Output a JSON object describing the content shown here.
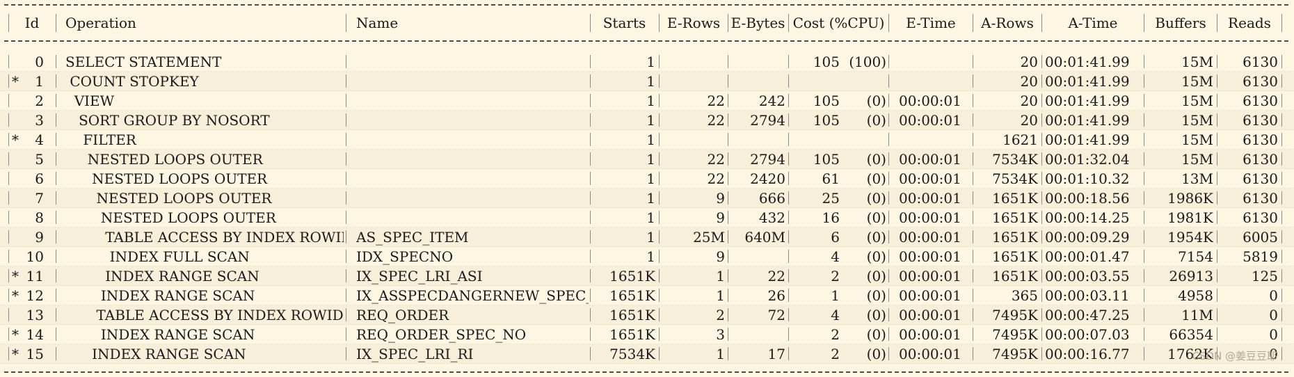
{
  "columns": {
    "id": "Id",
    "operation": "Operation",
    "name": "Name",
    "starts": "Starts",
    "erows": "E-Rows",
    "ebytes": "E-Bytes",
    "cost": "Cost (%CPU)",
    "etime": "E-Time",
    "arows": "A-Rows",
    "atime": "A-Time",
    "buffers": "Buffers",
    "reads": "Reads"
  },
  "rows": [
    {
      "mark": "",
      "id": "0",
      "operation": "SELECT STATEMENT",
      "name": "",
      "starts": "1",
      "erows": "",
      "ebytes": "",
      "cost": "105",
      "cpu": "(100)",
      "etime": "",
      "arows": "20",
      "atime": "00:01:41.99",
      "buffers": "15M",
      "reads": "6130"
    },
    {
      "mark": "*",
      "id": "1",
      "operation": " COUNT STOPKEY",
      "name": "",
      "starts": "1",
      "erows": "",
      "ebytes": "",
      "cost": "",
      "cpu": "",
      "etime": "",
      "arows": "20",
      "atime": "00:01:41.99",
      "buffers": "15M",
      "reads": "6130"
    },
    {
      "mark": "",
      "id": "2",
      "operation": "  VIEW",
      "name": "",
      "starts": "1",
      "erows": "22",
      "ebytes": "242",
      "cost": "105",
      "cpu": "(0)",
      "etime": "00:00:01",
      "arows": "20",
      "atime": "00:01:41.99",
      "buffers": "15M",
      "reads": "6130"
    },
    {
      "mark": "",
      "id": "3",
      "operation": "   SORT GROUP BY NOSORT",
      "name": "",
      "starts": "1",
      "erows": "22",
      "ebytes": "2794",
      "cost": "105",
      "cpu": "(0)",
      "etime": "00:00:01",
      "arows": "20",
      "atime": "00:01:41.99",
      "buffers": "15M",
      "reads": "6130"
    },
    {
      "mark": "*",
      "id": "4",
      "operation": "    FILTER",
      "name": "",
      "starts": "1",
      "erows": "",
      "ebytes": "",
      "cost": "",
      "cpu": "",
      "etime": "",
      "arows": "1621",
      "atime": "00:01:41.99",
      "buffers": "15M",
      "reads": "6130"
    },
    {
      "mark": "",
      "id": "5",
      "operation": "     NESTED LOOPS OUTER",
      "name": "",
      "starts": "1",
      "erows": "22",
      "ebytes": "2794",
      "cost": "105",
      "cpu": "(0)",
      "etime": "00:00:01",
      "arows": "7534K",
      "atime": "00:01:32.04",
      "buffers": "15M",
      "reads": "6130"
    },
    {
      "mark": "",
      "id": "6",
      "operation": "      NESTED LOOPS OUTER",
      "name": "",
      "starts": "1",
      "erows": "22",
      "ebytes": "2420",
      "cost": "61",
      "cpu": "(0)",
      "etime": "00:00:01",
      "arows": "7534K",
      "atime": "00:01:10.32",
      "buffers": "13M",
      "reads": "6130"
    },
    {
      "mark": "",
      "id": "7",
      "operation": "       NESTED LOOPS OUTER",
      "name": "",
      "starts": "1",
      "erows": "9",
      "ebytes": "666",
      "cost": "25",
      "cpu": "(0)",
      "etime": "00:00:01",
      "arows": "1651K",
      "atime": "00:00:18.56",
      "buffers": "1986K",
      "reads": "6130"
    },
    {
      "mark": "",
      "id": "8",
      "operation": "        NESTED LOOPS OUTER",
      "name": "",
      "starts": "1",
      "erows": "9",
      "ebytes": "432",
      "cost": "16",
      "cpu": "(0)",
      "etime": "00:00:01",
      "arows": "1651K",
      "atime": "00:00:14.25",
      "buffers": "1981K",
      "reads": "6130"
    },
    {
      "mark": "",
      "id": "9",
      "operation": "         TABLE ACCESS BY INDEX ROWID",
      "name": "AS_SPEC_ITEM",
      "starts": "1",
      "erows": "25M",
      "ebytes": "640M",
      "cost": "6",
      "cpu": "(0)",
      "etime": "00:00:01",
      "arows": "1651K",
      "atime": "00:00:09.29",
      "buffers": "1954K",
      "reads": "6005"
    },
    {
      "mark": "",
      "id": "10",
      "operation": "          INDEX FULL SCAN",
      "name": "IDX_SPECNO",
      "starts": "1",
      "erows": "9",
      "ebytes": "",
      "cost": "4",
      "cpu": "(0)",
      "etime": "00:00:01",
      "arows": "1651K",
      "atime": "00:00:01.47",
      "buffers": "7154",
      "reads": "5819"
    },
    {
      "mark": "*",
      "id": "11",
      "operation": "         INDEX RANGE SCAN",
      "name": "IX_SPEC_LRI_ASI",
      "starts": "1651K",
      "erows": "1",
      "ebytes": "22",
      "cost": "2",
      "cpu": "(0)",
      "etime": "00:00:01",
      "arows": "1651K",
      "atime": "00:00:03.55",
      "buffers": "26913",
      "reads": "125"
    },
    {
      "mark": "*",
      "id": "12",
      "operation": "        INDEX RANGE SCAN",
      "name": "IX_ASSPECDANGERNEW_SPEC_AI_OP",
      "starts": "1651K",
      "erows": "1",
      "ebytes": "26",
      "cost": "1",
      "cpu": "(0)",
      "etime": "00:00:01",
      "arows": "365",
      "atime": "00:00:03.11",
      "buffers": "4958",
      "reads": "0"
    },
    {
      "mark": "",
      "id": "13",
      "operation": "       TABLE ACCESS BY INDEX ROWID",
      "name": "REQ_ORDER",
      "starts": "1651K",
      "erows": "2",
      "ebytes": "72",
      "cost": "4",
      "cpu": "(0)",
      "etime": "00:00:01",
      "arows": "7495K",
      "atime": "00:00:47.25",
      "buffers": "11M",
      "reads": "0"
    },
    {
      "mark": "*",
      "id": "14",
      "operation": "        INDEX RANGE SCAN",
      "name": "REQ_ORDER_SPEC_NO",
      "starts": "1651K",
      "erows": "3",
      "ebytes": "",
      "cost": "2",
      "cpu": "(0)",
      "etime": "00:00:01",
      "arows": "7495K",
      "atime": "00:00:07.03",
      "buffers": "66354",
      "reads": "0"
    },
    {
      "mark": "*",
      "id": "15",
      "operation": "      INDEX RANGE SCAN",
      "name": "IX_SPEC_LRI_RI",
      "starts": "7534K",
      "erows": "1",
      "ebytes": "17",
      "cost": "2",
      "cpu": "(0)",
      "etime": "00:00:01",
      "arows": "7495K",
      "atime": "00:00:16.77",
      "buffers": "1762K",
      "reads": "0"
    }
  ],
  "watermark": "CSDN @姜豆豆耶"
}
